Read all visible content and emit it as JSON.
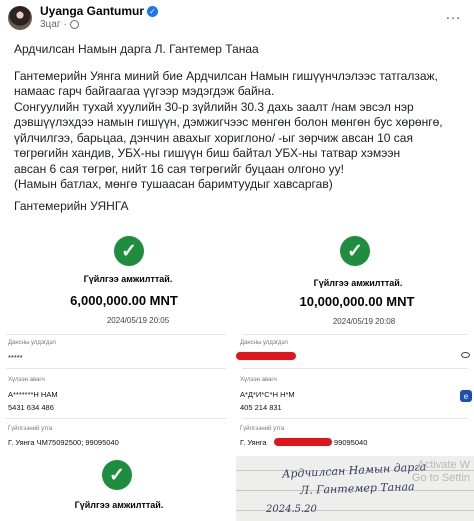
{
  "post": {
    "author": "Uyanga Gantumur",
    "time": "3цаг",
    "more_icon": "…",
    "title": "Ардчилсан Намын дарга Л. Гантемер Танаа",
    "paragraph": [
      "Гантемерийн Уянга миний бие Ардчилсан Намын гишүүнчлэлээс татгалзаж,",
      "намаас гарч байгаагаа үүгээр мэдэгдэж байна.",
      "Сонгуулийн тухай хуулийн 30-р зүйлийн 30.3 дахь заалт /нам эвсэл нэр",
      "дэвшүүлэхдээ намын гишүүн, дэмжигчээс мөнгөн болон мөнгөн бус хөрөнгө,",
      "үйлчилгээ, барьцаа, дэнчин авахыг хориглоно/ -ыг зөрчиж авсан 10 сая",
      "төгрөгийн хандив, УБХ-ны гишүүн биш байтал УБХ-ны татвар хэмээн",
      "авсан 6 сая төгрөг, нийт 16 сая төгрөгийг буцаан олгоно уу!",
      "(Намын батлах, мөнгө тушаасан баримтуудыг хавсаргав)"
    ],
    "signature": "Гантемерийн УЯНГА"
  },
  "receipts": [
    {
      "status": "Гүйлгээ амжилттай.",
      "amount": "6,000,000.00 MNT",
      "date": "2024/05/19 20:05",
      "account_label": "Дансны улдэгдэл",
      "account_value": "*****",
      "receiver_label": "Хүлээн авагч",
      "receiver_name": "А*******Н НАМ",
      "receiver_account": "5431 634 486",
      "desc_label": "Гүйлгээний утга",
      "desc_value": "Г. Уянга ЧМ75092500; 99095040"
    },
    {
      "status": "Гүйлгээ амжилттай.",
      "amount": "10,000,000.00 MNT",
      "date": "2024/05/19 20:08",
      "account_label": "Дансны улдэгдэл",
      "receiver_label": "Хүлээн авагч",
      "receiver_name": "А*Д*И*С*Н Н*М",
      "receiver_account": "405 214 831",
      "desc_label": "Гүйлгээний утга",
      "desc_prefix": "Г. Уянга",
      "desc_suffix": "99095040"
    },
    {
      "status": "Гүйлгээ амжилттай."
    }
  ],
  "handwritten": {
    "line1": "Ардчилсан Намын дарга",
    "line2": "Л. Гантемер Танаа",
    "date": "2024.5.20"
  },
  "watermark": {
    "line1": "Activate W",
    "line2": "Go to Settin"
  },
  "icons": {
    "check": "check-circle-icon",
    "verified": "verified-badge-icon",
    "globe": "globe-icon",
    "eye": "eye-icon",
    "bank": "bank-logo-icon"
  },
  "colors": {
    "success": "#1e8e3e",
    "redaction": "#e0141b",
    "verified": "#1877f2"
  }
}
